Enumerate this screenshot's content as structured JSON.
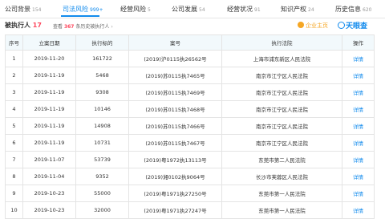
{
  "tabs": [
    {
      "label": "公司背景",
      "count": "154",
      "active": false
    },
    {
      "label": "司法风险",
      "count": "999+",
      "active": true
    },
    {
      "label": "经营风险",
      "count": "5",
      "active": false
    },
    {
      "label": "公司发展",
      "count": "54",
      "active": false
    },
    {
      "label": "经营状况",
      "count": "91",
      "active": false
    },
    {
      "label": "知识产权",
      "count": "24",
      "active": false
    },
    {
      "label": "历史信息",
      "count": "620",
      "active": false
    }
  ],
  "summary": {
    "title": "被执行人",
    "count": "17",
    "history_prefix": "查看",
    "history_count": "367",
    "history_suffix": "条历史被执行人",
    "history_arrow": "›",
    "vip_label": "企业主页",
    "brand": "天眼查"
  },
  "table": {
    "headers": [
      "序号",
      "立案日期",
      "执行标的",
      "案号",
      "执行法院",
      "操作"
    ],
    "rows": [
      {
        "no": "1",
        "date": "2019-11-20",
        "amount": "161722",
        "case": "(2019)沪0115执26562号",
        "court": "上海市浦东新区人民法院",
        "action": "详情"
      },
      {
        "no": "2",
        "date": "2019-11-19",
        "amount": "5468",
        "case": "(2019)苏0115执7465号",
        "court": "南京市江宁区人民法院",
        "action": "详情"
      },
      {
        "no": "3",
        "date": "2019-11-19",
        "amount": "9308",
        "case": "(2019)苏0115执7469号",
        "court": "南京市江宁区人民法院",
        "action": "详情"
      },
      {
        "no": "4",
        "date": "2019-11-19",
        "amount": "10146",
        "case": "(2019)苏0115执7468号",
        "court": "南京市江宁区人民法院",
        "action": "详情"
      },
      {
        "no": "5",
        "date": "2019-11-19",
        "amount": "14908",
        "case": "(2019)苏0115执7466号",
        "court": "南京市江宁区人民法院",
        "action": "详情"
      },
      {
        "no": "6",
        "date": "2019-11-19",
        "amount": "10731",
        "case": "(2019)苏0115执7467号",
        "court": "南京市江宁区人民法院",
        "action": "详情"
      },
      {
        "no": "7",
        "date": "2019-11-07",
        "amount": "53739",
        "case": "(2019)粤1972执13113号",
        "court": "东莞市第二人民法院",
        "action": "详情"
      },
      {
        "no": "8",
        "date": "2019-11-04",
        "amount": "9352",
        "case": "(2019)湘0102执9064号",
        "court": "长沙市芙蓉区人民法院",
        "action": "详情"
      },
      {
        "no": "9",
        "date": "2019-10-23",
        "amount": "55000",
        "case": "(2019)粤1971执27250号",
        "court": "东莞市第一人民法院",
        "action": "详情"
      },
      {
        "no": "10",
        "date": "2019-10-23",
        "amount": "32000",
        "case": "(2019)粤1971执27247号",
        "court": "东莞市第一人民法院",
        "action": "详情"
      }
    ]
  }
}
